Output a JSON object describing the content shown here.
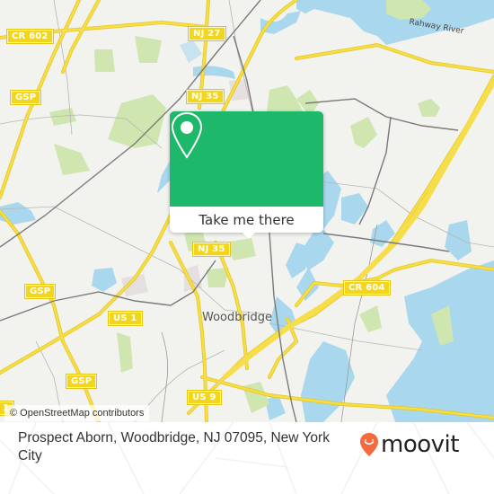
{
  "map": {
    "road_shields": [
      {
        "label": "CR 602",
        "name": "shield-cr-602"
      },
      {
        "label": "NJ 27",
        "name": "shield-nj-27"
      },
      {
        "label": "GSP",
        "name": "shield-gsp-1"
      },
      {
        "label": "NJ 35",
        "name": "shield-nj-35-north"
      },
      {
        "label": "GSP",
        "name": "shield-gsp-2"
      },
      {
        "label": "NJ 35",
        "name": "shield-nj-35-south"
      },
      {
        "label": "US 1",
        "name": "shield-us-1"
      },
      {
        "label": "GSP",
        "name": "shield-gsp-3"
      },
      {
        "label": "US 9",
        "name": "shield-us-9"
      },
      {
        "label": "CR 604",
        "name": "shield-cr-604"
      },
      {
        "label": "1",
        "name": "shield-us-1-edge"
      }
    ],
    "place_label": "Woodbridge",
    "water_label": "Rahway River",
    "attribution": "© OpenStreetMap contributors",
    "colors": {
      "land": "#f2f2ef",
      "water": "#a9d8ee",
      "park": "#cfe6b0",
      "road_major": "#f6dd4a",
      "shield": "#f3d51b",
      "rail": "#777777"
    }
  },
  "popup": {
    "icon": "location-pin-icon",
    "button_label": "Take me there",
    "color": "#1db869"
  },
  "footer": {
    "address": "Prospect Aborn, Woodbridge, NJ 07095, New York City",
    "logo_text": "moovit",
    "logo_icon": "moovit-pin-icon",
    "logo_color": "#f26a3d"
  }
}
